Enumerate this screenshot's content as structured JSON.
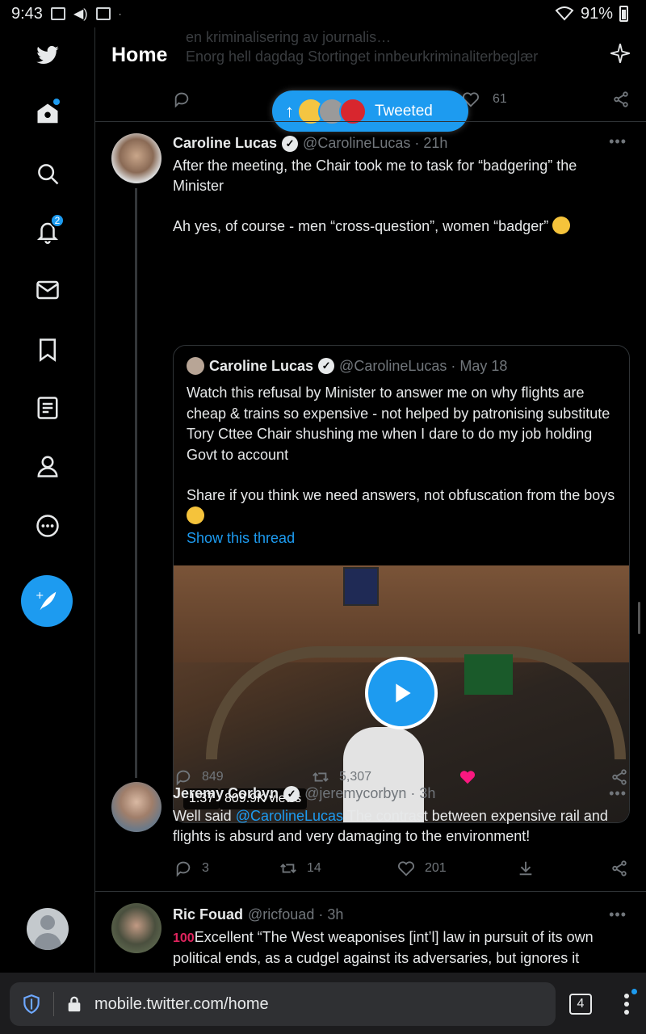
{
  "status_bar": {
    "time": "9:43",
    "battery": "91%"
  },
  "header": {
    "title": "Home"
  },
  "behind_text": {
    "line1": "en kriminalisering av journalis…",
    "line2": "Enorg hell dagdag Stortinget innbeurkriminaliterbeglær"
  },
  "prev_tweet": {
    "likes": "61"
  },
  "new_tweets_pill": {
    "label": "Tweeted"
  },
  "sidebar": {
    "notifications_count": "2"
  },
  "tweets": [
    {
      "name": "Caroline Lucas",
      "handle": "@CarolineLucas · 21h",
      "text_1": "After the meeting, the Chair took me to task for “badgering” the Minister",
      "text_2": "Ah yes, of course - men “cross-question”, women “badger”",
      "quote": {
        "name": "Caroline Lucas",
        "handle": "@CarolineLucas · May 18",
        "text_1": "Watch this refusal by Minister to answer me on why flights are cheap & trains so expensive - not helped by patronising substitute Tory Cttee Chair shushing me when I dare to do my job holding Govt to account",
        "text_2": "Share if you think we need answers, not obfuscation from the boys",
        "show_thread": "Show this thread",
        "video_duration": "1:37",
        "video_views": "809.9K views"
      },
      "replies": "849",
      "retweets": "5,307"
    },
    {
      "name": "Jeremy Corbyn",
      "handle": "@jeremycorbyn · 3h",
      "mention": "@CarolineLucas",
      "text": " The contrast between expensive rail and flights is absurd and very damaging to the environment!",
      "text_prefix": "Well said ",
      "replies": "3",
      "retweets": "14",
      "likes": "201"
    },
    {
      "name": "Ric Fouad",
      "handle": "@ricfouad · 3h",
      "text": "Excellent “The West weaponises [int’l] law in pursuit of its own political ends, as a cudgel against its adversaries, but ignores it"
    }
  ],
  "browser": {
    "url": "mobile.twitter.com/home",
    "tabs": "4"
  },
  "colors": {
    "accent": "#1d9bf0",
    "like": "#f91880",
    "background": "#000000"
  }
}
